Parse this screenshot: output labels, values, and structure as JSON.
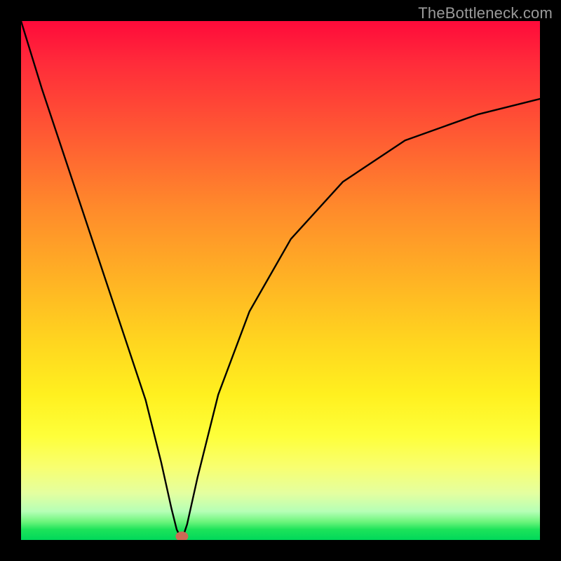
{
  "watermark": "TheBottleneck.com",
  "chart_data": {
    "type": "line",
    "title": "",
    "xlabel": "",
    "ylabel": "",
    "xlim": [
      0,
      100
    ],
    "ylim": [
      0,
      100
    ],
    "optimum_x": 31,
    "series": [
      {
        "name": "bottleneck-curve",
        "x": [
          0,
          4,
          8,
          12,
          16,
          20,
          24,
          27,
          29,
          30,
          31,
          32,
          34,
          38,
          44,
          52,
          62,
          74,
          88,
          100
        ],
        "y": [
          100,
          87,
          75,
          63,
          51,
          39,
          27,
          15,
          6,
          2,
          0,
          3,
          12,
          28,
          44,
          58,
          69,
          77,
          82,
          85
        ]
      }
    ],
    "annotations": [
      {
        "type": "dot",
        "x": 31,
        "y": 0,
        "name": "optimum-point"
      }
    ],
    "background_gradient": {
      "top_color": "#ff0a3a",
      "mid_color": "#ffd61f",
      "bottom_color": "#00d85a"
    }
  }
}
